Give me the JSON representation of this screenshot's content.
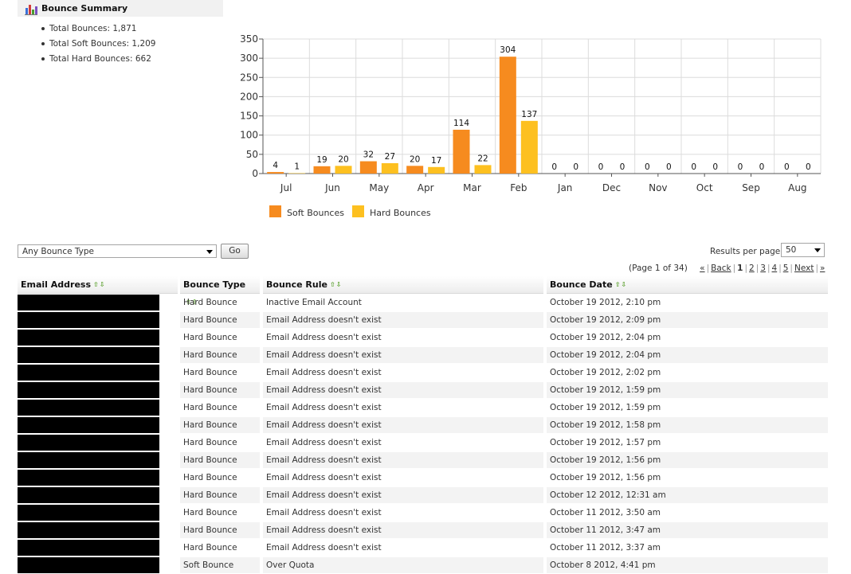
{
  "summary": {
    "title": "Bounce Summary",
    "items": [
      "Total Bounces: 1,871",
      "Total Soft Bounces: 1,209",
      "Total Hard Bounces: 662"
    ]
  },
  "chart_data": {
    "type": "bar",
    "categories": [
      "Jul",
      "Jun",
      "May",
      "Apr",
      "Mar",
      "Feb",
      "Jan",
      "Dec",
      "Nov",
      "Oct",
      "Sep",
      "Aug"
    ],
    "series": [
      {
        "name": "Soft Bounces",
        "color": "#f68b1f",
        "values": [
          4,
          19,
          32,
          20,
          114,
          304,
          0,
          0,
          0,
          0,
          0,
          0
        ]
      },
      {
        "name": "Hard Bounces",
        "color": "#fdc020",
        "values": [
          1,
          20,
          27,
          17,
          22,
          137,
          0,
          0,
          0,
          0,
          0,
          0
        ]
      }
    ],
    "ylim": [
      0,
      350
    ],
    "yticks": [
      0,
      50,
      100,
      150,
      200,
      250,
      300,
      350
    ],
    "grid": true,
    "legend": "bottom-left"
  },
  "controls": {
    "filter_value": "Any Bounce Type",
    "go_label": "Go",
    "rpp_label": "Results per page:",
    "rpp_value": "50"
  },
  "pager": {
    "info": "(Page 1 of 34)",
    "first": "«",
    "back": "Back",
    "pages": [
      "1",
      "2",
      "3",
      "4",
      "5"
    ],
    "next": "Next",
    "last": "»"
  },
  "table": {
    "headers": [
      "Email Address",
      "Bounce Type",
      "Bounce Rule",
      "Bounce Date"
    ],
    "sort_icon": "⇧⇩",
    "rows": [
      [
        "Hard Bounce",
        "Inactive Email Account",
        "October 19 2012, 2:10 pm"
      ],
      [
        "Hard Bounce",
        "Email Address doesn't exist",
        "October 19 2012, 2:09 pm"
      ],
      [
        "Hard Bounce",
        "Email Address doesn't exist",
        "October 19 2012, 2:04 pm"
      ],
      [
        "Hard Bounce",
        "Email Address doesn't exist",
        "October 19 2012, 2:04 pm"
      ],
      [
        "Hard Bounce",
        "Email Address doesn't exist",
        "October 19 2012, 2:02 pm"
      ],
      [
        "Hard Bounce",
        "Email Address doesn't exist",
        "October 19 2012, 1:59 pm"
      ],
      [
        "Hard Bounce",
        "Email Address doesn't exist",
        "October 19 2012, 1:59 pm"
      ],
      [
        "Hard Bounce",
        "Email Address doesn't exist",
        "October 19 2012, 1:58 pm"
      ],
      [
        "Hard Bounce",
        "Email Address doesn't exist",
        "October 19 2012, 1:57 pm"
      ],
      [
        "Hard Bounce",
        "Email Address doesn't exist",
        "October 19 2012, 1:56 pm"
      ],
      [
        "Hard Bounce",
        "Email Address doesn't exist",
        "October 19 2012, 1:56 pm"
      ],
      [
        "Hard Bounce",
        "Email Address doesn't exist",
        "October 12 2012, 12:31 am"
      ],
      [
        "Hard Bounce",
        "Email Address doesn't exist",
        "October 11 2012, 3:50 am"
      ],
      [
        "Hard Bounce",
        "Email Address doesn't exist",
        "October 11 2012, 3:47 am"
      ],
      [
        "Hard Bounce",
        "Email Address doesn't exist",
        "October 11 2012, 3:37 am"
      ],
      [
        "Soft Bounce",
        "Over Quota",
        "October 8 2012, 4:41 pm"
      ]
    ]
  }
}
